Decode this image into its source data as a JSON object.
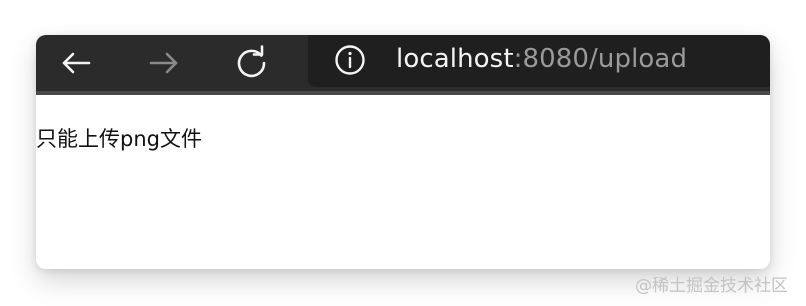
{
  "toolbar": {
    "back": {
      "icon": "back-arrow-icon"
    },
    "forward": {
      "icon": "forward-arrow-icon"
    },
    "reload": {
      "icon": "reload-icon"
    },
    "address_bar": {
      "info_icon": "info-icon",
      "url_host": "localhost",
      "url_rest": ":8080/upload"
    }
  },
  "content": {
    "message": "只能上传png文件"
  },
  "watermark": {
    "text": "@稀土掘金技术社区"
  },
  "colors": {
    "toolbar_bg": "#2b2b2b",
    "address_bg": "#1f1f1f",
    "active_icon": "#f4f4f4",
    "disabled_icon": "#8a8a8a",
    "url_secondary": "#9a9a9a",
    "page_bg": "#ffffff",
    "text": "#111111",
    "watermark": "#c3c3c3"
  }
}
